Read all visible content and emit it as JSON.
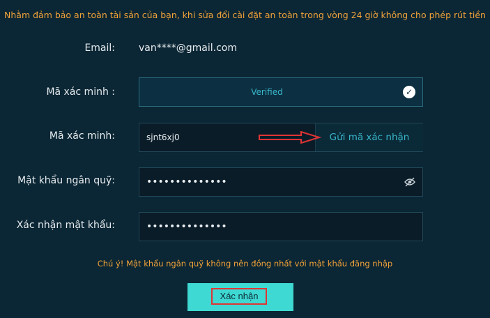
{
  "notice": "Nhằm đảm bảo an toàn tài sản của bạn, khi sửa đổi cài đặt an toàn trong vòng 24 giờ không cho phép rút tiền",
  "form": {
    "email_label": "Email:",
    "email_value": "van****@gmail.com",
    "verify_label": "Mã xác minh :",
    "verified_text": "Verified",
    "code_label": "Mã xác minh:",
    "code_value": "sjnt6xj0",
    "send_code_label": "Gửi mã xác nhận",
    "fund_pwd_label": "Mật khẩu ngân quỹ:",
    "fund_pwd_value": "••••••••••••••",
    "confirm_pwd_label": "Xác nhận mật khẩu:",
    "confirm_pwd_value": "••••••••••••••"
  },
  "hint": "Chú ý! Mật khẩu ngân quỹ không nên đồng nhất với mật khẩu đăng nhập",
  "confirm_button": "Xác nhận",
  "colors": {
    "background": "#0b2634",
    "accent": "#3ed9d2",
    "warning": "#f2a33a",
    "highlight_red": "#e03434"
  },
  "icons": {
    "verified": "check-circle-icon",
    "password_visibility": "eye-off-icon",
    "annotation": "arrow-right-icon"
  }
}
